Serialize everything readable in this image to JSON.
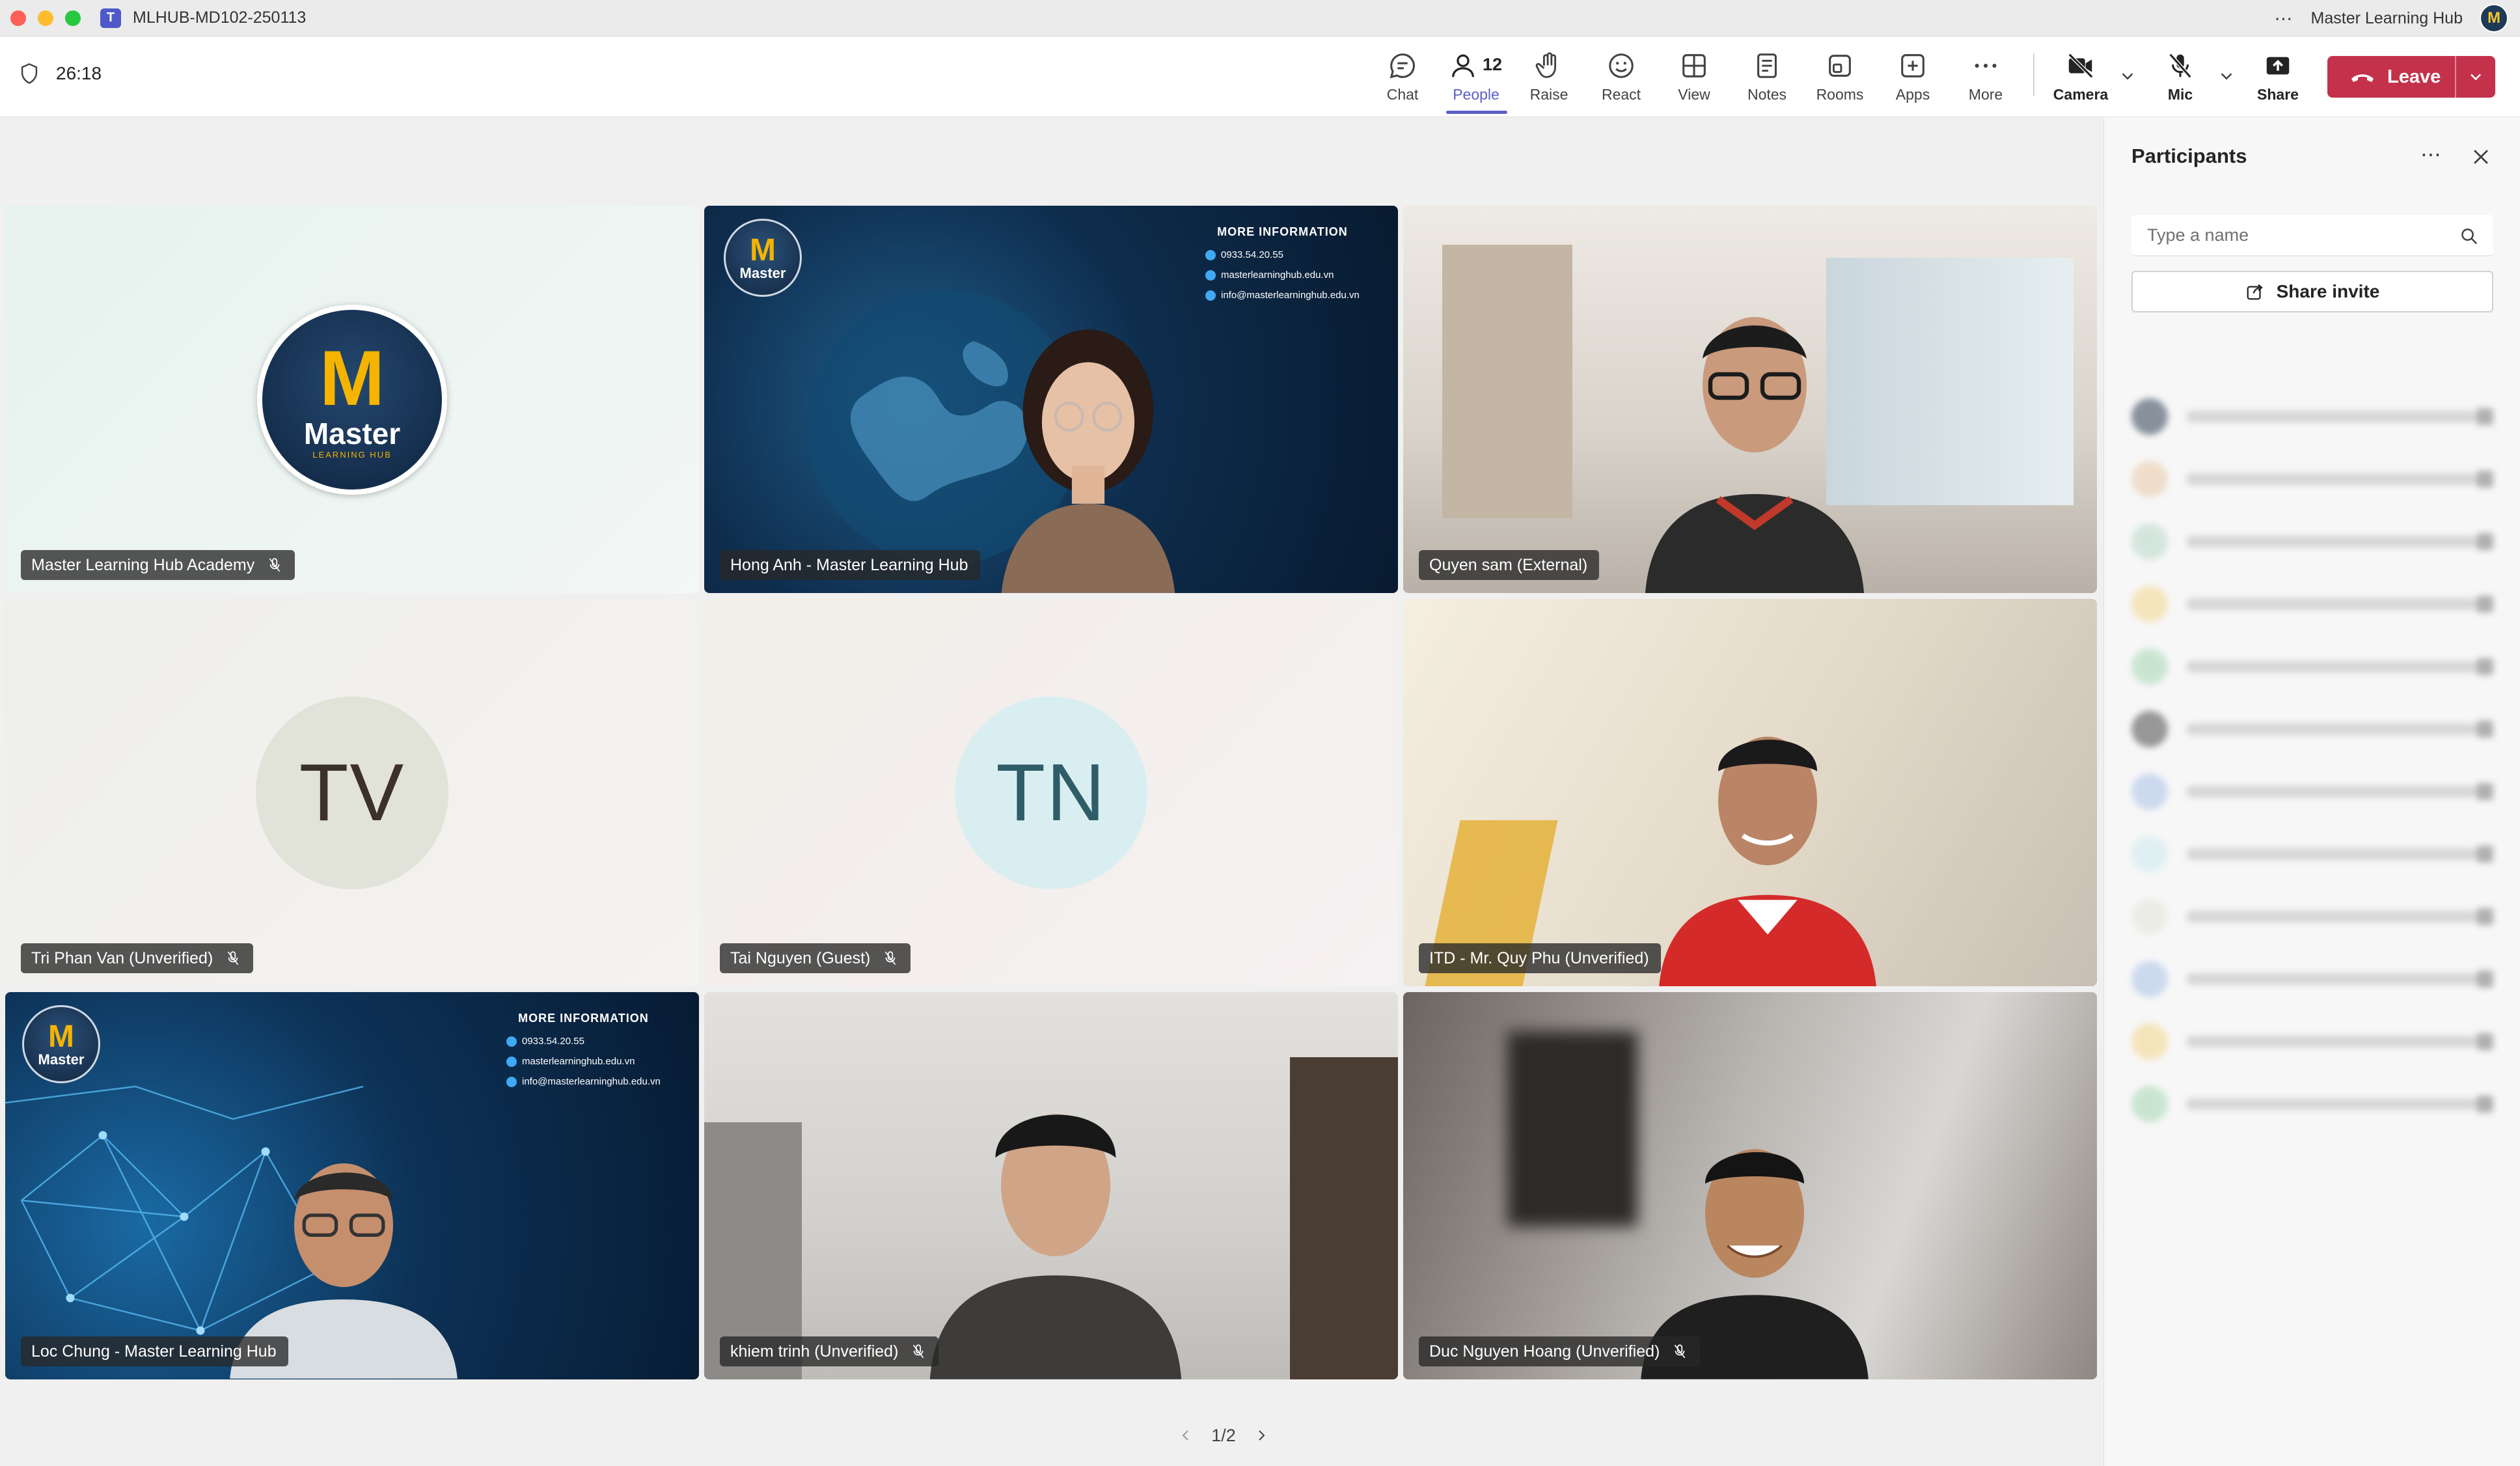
{
  "window": {
    "title": "MLHUB-MD102-250113",
    "org": "Master Learning Hub",
    "org_initial": "M",
    "menu": "⋯"
  },
  "timer": "26:18",
  "toolbar": {
    "chat": "Chat",
    "people": "People",
    "people_count": "12",
    "raise": "Raise",
    "react": "React",
    "view": "View",
    "notes": "Notes",
    "rooms": "Rooms",
    "apps": "Apps",
    "more": "More",
    "camera": "Camera",
    "mic": "Mic",
    "share": "Share",
    "leave": "Leave"
  },
  "tiles": [
    {
      "name": "Master Learning Hub Academy",
      "muted": true,
      "kind": "logo"
    },
    {
      "name": "Hong Anh - Master Learning Hub",
      "muted": false,
      "kind": "video-blue"
    },
    {
      "name": "Quyen sam (External)",
      "muted": false,
      "kind": "video-room"
    },
    {
      "name": "Tri Phan Van (Unverified)",
      "muted": true,
      "kind": "avatar",
      "initials": "TV"
    },
    {
      "name": "Tai Nguyen (Guest)",
      "muted": true,
      "kind": "avatar",
      "initials": "TN"
    },
    {
      "name": "ITD - Mr. Quy Phu (Unverified)",
      "muted": false,
      "kind": "video-home"
    },
    {
      "name": "Loc Chung - Master Learning Hub",
      "muted": false,
      "kind": "video-blue-net"
    },
    {
      "name": "khiem trinh (Unverified)",
      "muted": true,
      "kind": "video-gray"
    },
    {
      "name": "Duc Nguyen Hoang (Unverified)",
      "muted": true,
      "kind": "video-blur"
    }
  ],
  "logo": {
    "letter": "M",
    "word": "Master",
    "sub": "LEARNING HUB"
  },
  "info": {
    "heading": "MORE INFORMATION",
    "phone": "0933.54.20.55",
    "web": "masterlearninghub.edu.vn",
    "email": "info@masterlearninghub.edu.vn"
  },
  "pager": "1/2",
  "panel": {
    "title": "Participants",
    "search_placeholder": "Type a name",
    "share_invite": "Share invite",
    "more": "⋯"
  },
  "colors": {
    "accent": "#5b5fc7",
    "leave": "#c4314b",
    "tag_bg": "#282828"
  }
}
